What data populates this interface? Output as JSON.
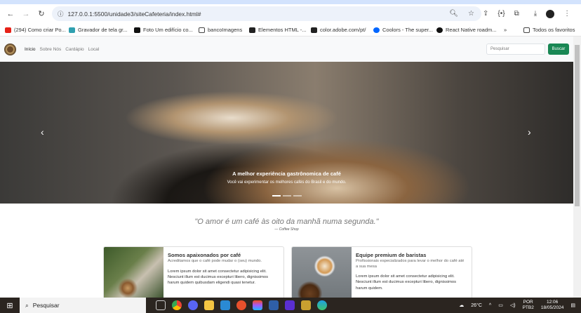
{
  "browser": {
    "url": "127.0.0.1:5500/unidade3/siteCafeteria/index.html#",
    "bookmarks": [
      {
        "label": "(294) Como criar Po...",
        "color": "#e62117"
      },
      {
        "label": "Gravador de tela gr...",
        "color": "#30a0b0"
      },
      {
        "label": "Foto Um edifício co...",
        "color": "#111111"
      },
      {
        "label": "bancoImagens",
        "color": "#ffffff"
      },
      {
        "label": "Elementos HTML -...",
        "color": "#222222"
      },
      {
        "label": "color.adobe.com/pt/",
        "color": "#222222"
      },
      {
        "label": "Coolors - The super...",
        "color": "#0066ff"
      },
      {
        "label": "React Native roadm...",
        "color": "#111111"
      }
    ],
    "more": "»",
    "all_favorites": "Todos os favoritos"
  },
  "navbar": {
    "links": [
      "Início",
      "Sobre Nós",
      "Cardápio",
      "Local"
    ],
    "search_placeholder": "Pesquisar",
    "search_button": "Buscar"
  },
  "carousel": {
    "title": "A melhor experiência gastrônomica de café",
    "text": "Você vai experimentar os melhores cafés do Brasil e do mundo.",
    "slides": 3,
    "active": 0
  },
  "quote": {
    "text": "\"O amor é um café às oito da manhã numa segunda.\"",
    "author": "— Coffee Shop"
  },
  "cards": [
    {
      "title": "Somos apaixonados por café",
      "subtitle": "Acreditamos que o café pode mudar o (seu) mundo.",
      "text": "Lorem ipsum dolor sit amet consectetur adipisicing elit. Nesciunt illum est ducimus excepturi libero, dignissimos harum quidem quibusdam eligendi quasi tenetur."
    },
    {
      "title": "Equipe premium de baristas",
      "subtitle": "Profissionais especializados para levar o melhor do café até a sua mesa",
      "text": "Lorem ipsum dolor sit amet consectetur adipisicing elit. Nesciunt illum est ducimus excepturi libero, dignissimos harum quidem."
    }
  ],
  "taskbar": {
    "search": "Pesquisar",
    "weather": "26°C",
    "lang": "POR",
    "layout": "PTB2",
    "time": "12:06",
    "date": "18/05/2024"
  }
}
